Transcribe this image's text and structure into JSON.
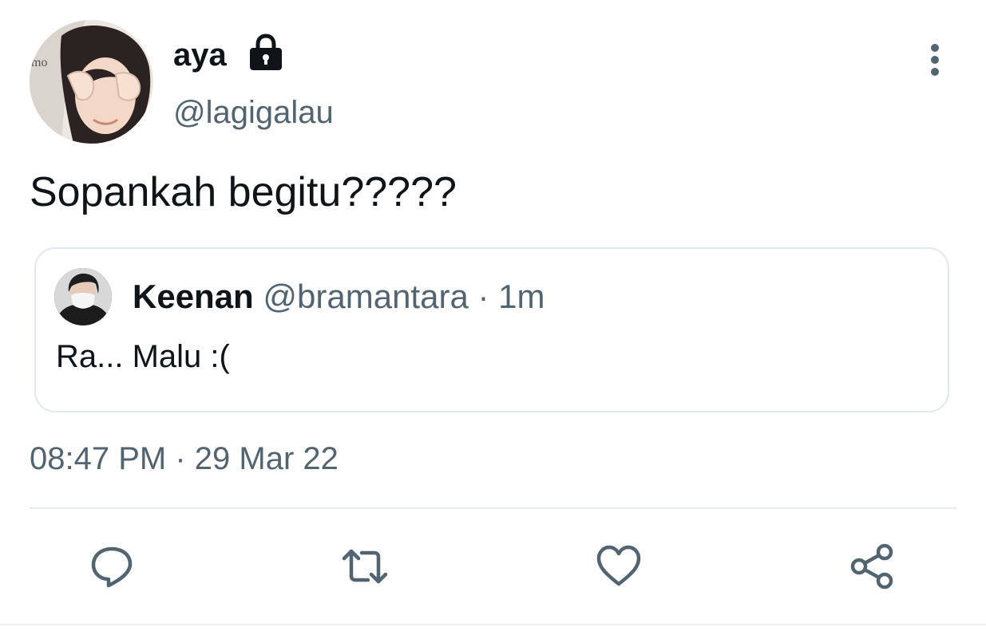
{
  "tweet": {
    "author": {
      "name": "aya",
      "handle": "@lagigalau",
      "avatar_icon": "user-photo-avatar",
      "protected_icon": "lock-icon"
    },
    "text": "Sopankah begitu?????",
    "timestamp": "08:47 PM",
    "date_separator": "·",
    "date": "29 Mar 22",
    "more_icon": "more-vertical-icon"
  },
  "quoted_tweet": {
    "name": "Keenan",
    "handle": "@bramantara",
    "separator": "·",
    "time_ago": "1m",
    "text": "Ra... Malu :(",
    "avatar_icon": "user-photo-avatar"
  },
  "actions": [
    {
      "icon": "reply-icon"
    },
    {
      "icon": "retweet-icon"
    },
    {
      "icon": "heart-icon"
    },
    {
      "icon": "share-icon"
    }
  ],
  "colors": {
    "primary_text": "#0f1419",
    "secondary_text": "#536471",
    "border": "#e3e8ec",
    "icon": "#536471"
  }
}
